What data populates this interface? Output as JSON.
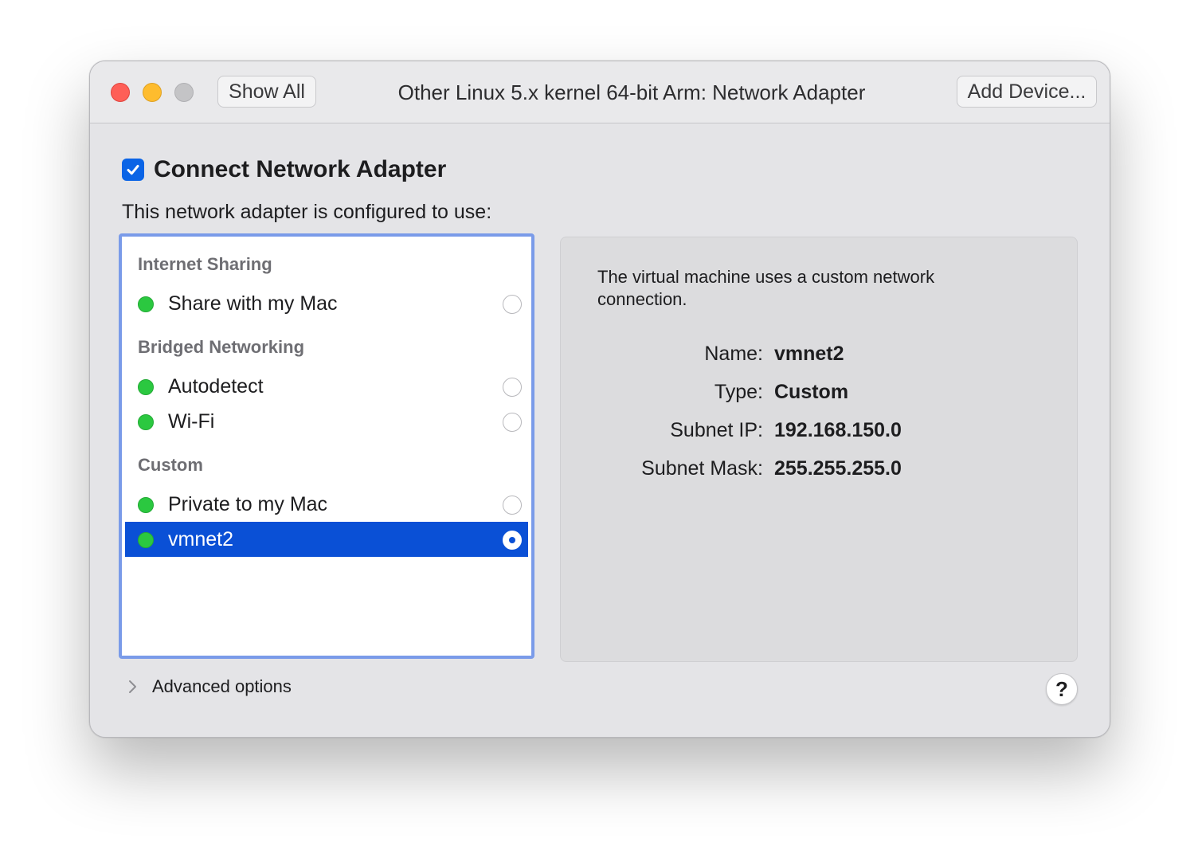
{
  "window": {
    "title": "Other Linux 5.x kernel 64-bit Arm: Network Adapter",
    "show_all_label": "Show All",
    "add_device_label": "Add Device..."
  },
  "connect": {
    "checked": true,
    "label": "Connect Network Adapter"
  },
  "subtitle": "This network adapter is configured to use:",
  "list": {
    "sections": [
      {
        "title": "Internet Sharing",
        "items": [
          {
            "label": "Share with my Mac",
            "selected": false
          }
        ]
      },
      {
        "title": "Bridged Networking",
        "items": [
          {
            "label": "Autodetect",
            "selected": false
          },
          {
            "label": "Wi-Fi",
            "selected": false
          }
        ]
      },
      {
        "title": "Custom",
        "items": [
          {
            "label": "Private to my Mac",
            "selected": false
          },
          {
            "label": "vmnet2",
            "selected": true
          }
        ]
      }
    ]
  },
  "info": {
    "description": "The virtual machine uses a custom network connection.",
    "fields": [
      {
        "key": "Name:",
        "value": "vmnet2"
      },
      {
        "key": "Type:",
        "value": "Custom"
      },
      {
        "key": "Subnet IP:",
        "value": "192.168.150.0"
      },
      {
        "key": "Subnet Mask:",
        "value": "255.255.255.0"
      }
    ]
  },
  "advanced_label": "Advanced options",
  "help_label": "?",
  "colors": {
    "status_dot": "#2bc840",
    "selection": "#0a50d6",
    "focus_ring": "#7a9be9"
  }
}
